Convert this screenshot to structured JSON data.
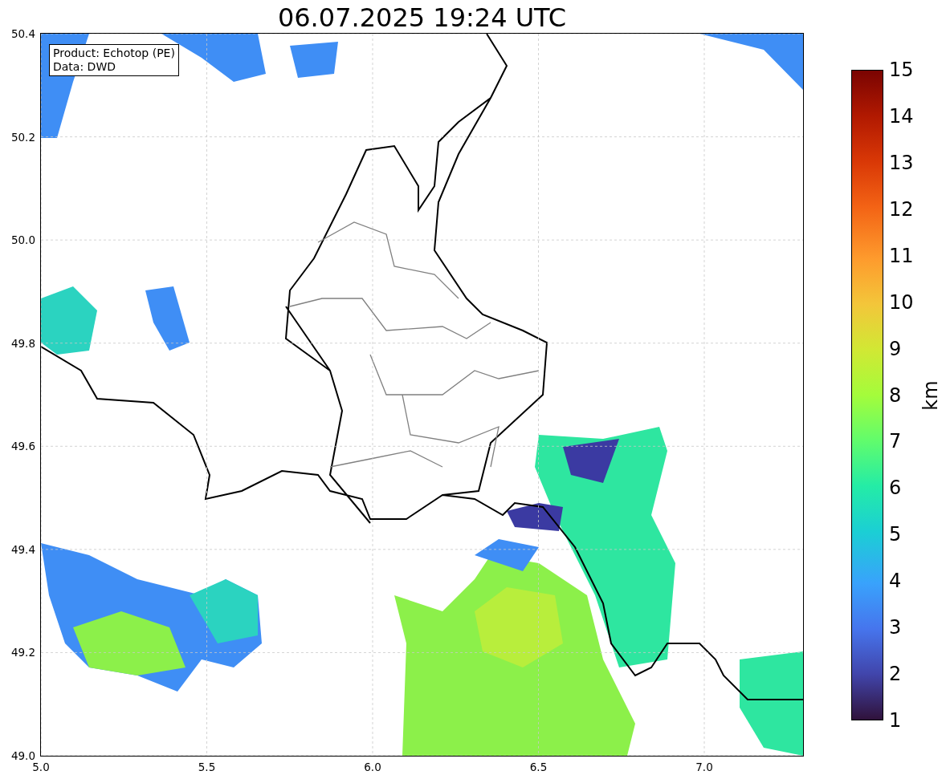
{
  "title": "06.07.2025 19:24 UTC",
  "map": {
    "legend": [
      "Product: Echotop (PE)",
      "Data: DWD"
    ],
    "x_ticks": [
      "5.0",
      "5.5",
      "6.0",
      "6.5",
      "7.0"
    ],
    "y_ticks": [
      "50.4",
      "50.2",
      "50.0",
      "49.8",
      "49.6",
      "49.4",
      "49.2",
      "49.0"
    ]
  },
  "colorbar": {
    "label": "km",
    "ticks": [
      "15",
      "14",
      "13",
      "12",
      "11",
      "10",
      "9",
      "8",
      "7",
      "6",
      "5",
      "4",
      "3",
      "2",
      "1"
    ]
  }
}
